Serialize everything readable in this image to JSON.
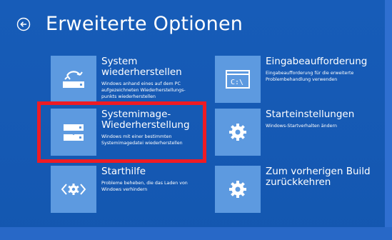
{
  "header": {
    "title": "Erweiterte Optionen"
  },
  "options": [
    {
      "title_lines": [
        "System",
        "wiederherstellen"
      ],
      "desc_lines": [
        "Windows anhand eines auf dem PC",
        "aufgezeichneten Wiederherstellungs-",
        "punkts wiederherstellen"
      ],
      "icon": "restore-icon"
    },
    {
      "title_lines": [
        "Eingabeaufforderung"
      ],
      "desc_lines": [
        "Eingabeaufforderung für die erweiterte",
        "Problembehandlung verwenden"
      ],
      "icon": "command-prompt-icon"
    },
    {
      "title_lines": [
        "Systemimage-",
        "Wiederherstellung"
      ],
      "desc_lines": [
        "Windows mit einer bestimmten",
        "Systemimagedatei wiederherstellen"
      ],
      "icon": "system-image-icon"
    },
    {
      "title_lines": [
        "Starteinstellungen"
      ],
      "desc_lines": [
        "Windows-Startverhalten ändern"
      ],
      "icon": "gear-icon"
    },
    {
      "title_lines": [
        "Starthilfe"
      ],
      "desc_lines": [
        "Probleme beheben, die das Laden von",
        "Windows verhindern"
      ],
      "icon": "startup-repair-icon"
    },
    {
      "title_lines": [
        "Zum vorherigen Build",
        "zurückkehren"
      ],
      "desc_lines": [],
      "icon": "gear-icon"
    }
  ],
  "highlighted_option": "Systemimage-Wiederherstellung",
  "colors": {
    "background": "#1559b3",
    "tile": "#5d9ae0",
    "highlight": "#ef1b24"
  }
}
